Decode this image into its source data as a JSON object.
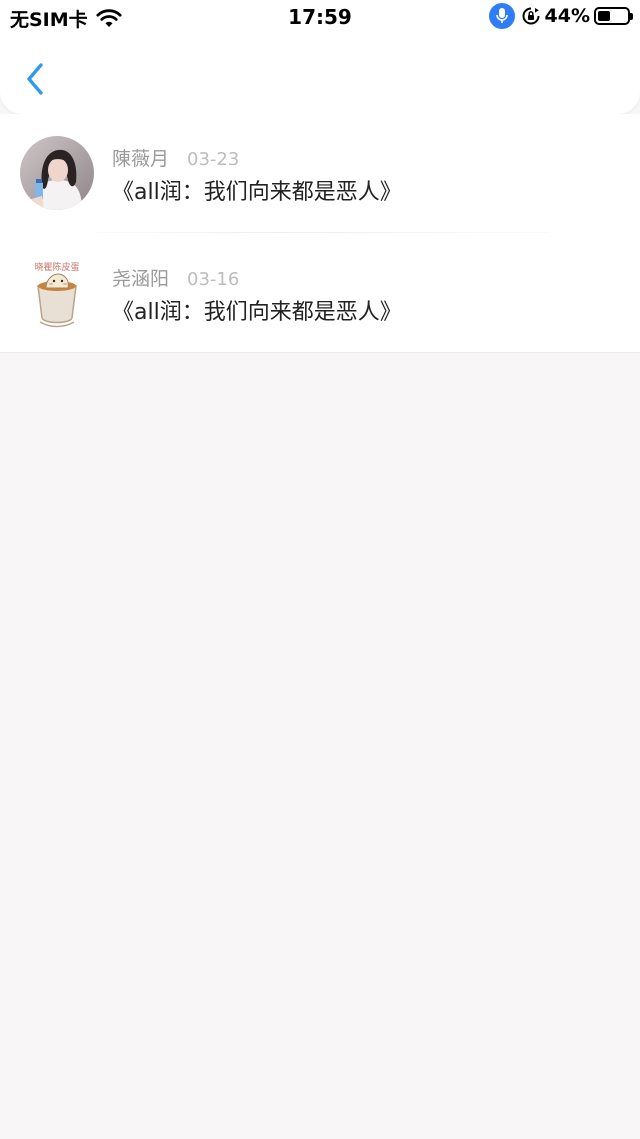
{
  "status_bar": {
    "carrier": "无SIM卡",
    "time": "17:59",
    "battery_percent": "44%",
    "battery_level": 0.44
  },
  "nav": {
    "back_icon": "chevron-left-icon",
    "accent_color": "#2f9bea"
  },
  "messages": [
    {
      "name": "陳薇月",
      "date": "03-23",
      "text": "《all润：我们向来都是恶人》",
      "avatar": "profile photo (girl with bottle)"
    },
    {
      "name": "尧涵阳",
      "date": "03-16",
      "text": "《all润：我们向来都是恶人》",
      "avatar": "cartoon dumpling in cup",
      "avatar_text": "晓瞿陈皮蛋"
    }
  ]
}
